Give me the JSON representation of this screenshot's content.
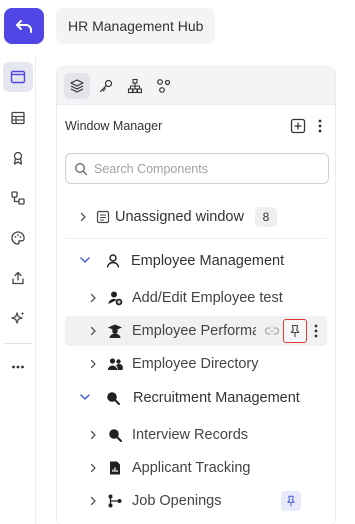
{
  "header": {
    "back_icon": "undo-arrow-icon",
    "title": "HR Management Hub",
    "accent": "#4f46e5"
  },
  "rail": {
    "items": [
      {
        "icon": "window-icon",
        "active": true
      },
      {
        "icon": "table-icon",
        "active": false
      },
      {
        "icon": "award-icon",
        "active": false
      },
      {
        "icon": "workflow-icon",
        "active": false
      },
      {
        "icon": "palette-icon",
        "active": false
      },
      {
        "icon": "share-upload-icon",
        "active": false
      },
      {
        "icon": "sparkle-icon",
        "active": false
      },
      {
        "icon": "more-horizontal-icon",
        "active": false
      }
    ]
  },
  "toolbar": {
    "tools": [
      {
        "icon": "layers-icon",
        "active": true
      },
      {
        "icon": "key-icon",
        "active": false
      },
      {
        "icon": "hierarchy-icon",
        "active": false
      },
      {
        "icon": "nodes-icon",
        "active": false
      }
    ]
  },
  "window_manager": {
    "title": "Window Manager",
    "search_placeholder": "Search Components",
    "unassigned": {
      "label": "Unassigned window",
      "count": "8"
    },
    "groups": [
      {
        "label": "Employee Management",
        "icon": "user-icon",
        "children": [
          {
            "label": "Add/Edit Employee test",
            "icon": "user-add-icon"
          },
          {
            "label": "Employee Performance Review",
            "icon": "graduate-icon",
            "hovered": true
          },
          {
            "label": "Employee Directory",
            "icon": "users-icon"
          }
        ]
      },
      {
        "label": "Recruitment Management",
        "icon": "search-icon",
        "children": [
          {
            "label": "Interview Records",
            "icon": "search-icon"
          },
          {
            "label": "Applicant Tracking",
            "icon": "file-chart-icon"
          },
          {
            "label": "Job Openings",
            "icon": "branch-icon",
            "pinned": true
          }
        ]
      }
    ]
  },
  "colors": {
    "highlight_border": "#e53935",
    "chevron_expanded": "#3b5bdb",
    "pin_active_bg": "#e7e9fb"
  }
}
